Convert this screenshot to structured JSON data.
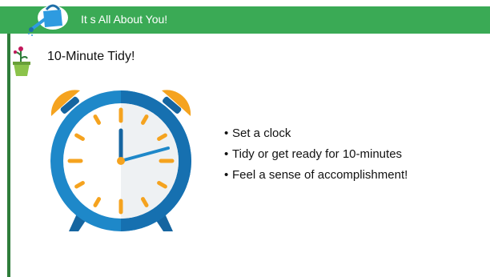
{
  "header": {
    "title": "It s All About You!",
    "bar_color": "#3aaa55"
  },
  "slide": {
    "title": "10-Minute Tidy!",
    "bullets": [
      "Set a clock",
      "Tidy or get ready for 10-minutes",
      "Feel a sense of accomplishment!"
    ]
  },
  "icons": {
    "logo": "watering-can-icon",
    "pot": "flower-pot-icon",
    "clock": "alarm-clock-icon"
  },
  "colors": {
    "clock_blue": "#1e88c9",
    "clock_orange": "#f5a31f",
    "accent_green": "#2e7d3a"
  }
}
